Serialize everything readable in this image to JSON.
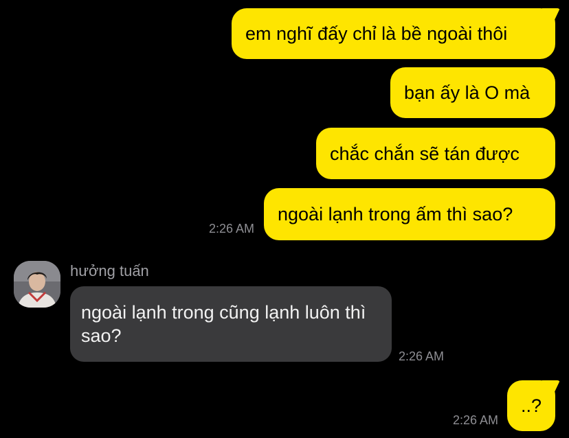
{
  "messages": {
    "outgoing_1": "em nghĩ đấy chỉ là bề ngoài thôi",
    "outgoing_2": "bạn ấy là O mà",
    "outgoing_3": "chắc chắn sẽ tán được",
    "outgoing_4": "ngoài lạnh trong ấm thì sao?",
    "outgoing_4_time": "2:26 AM",
    "incoming_sender": "hưởng tuấn",
    "incoming_1": "ngoài lạnh trong cũng lạnh luôn thì sao?",
    "incoming_1_time": "2:26 AM",
    "outgoing_5": "..?",
    "outgoing_5_time": "2:26 AM"
  },
  "colors": {
    "background": "#000000",
    "outgoing_bubble": "#FEE500",
    "incoming_bubble": "#3A3A3C",
    "timestamp": "#8E8E93"
  },
  "icons": {
    "avatar": "profile-photo"
  }
}
